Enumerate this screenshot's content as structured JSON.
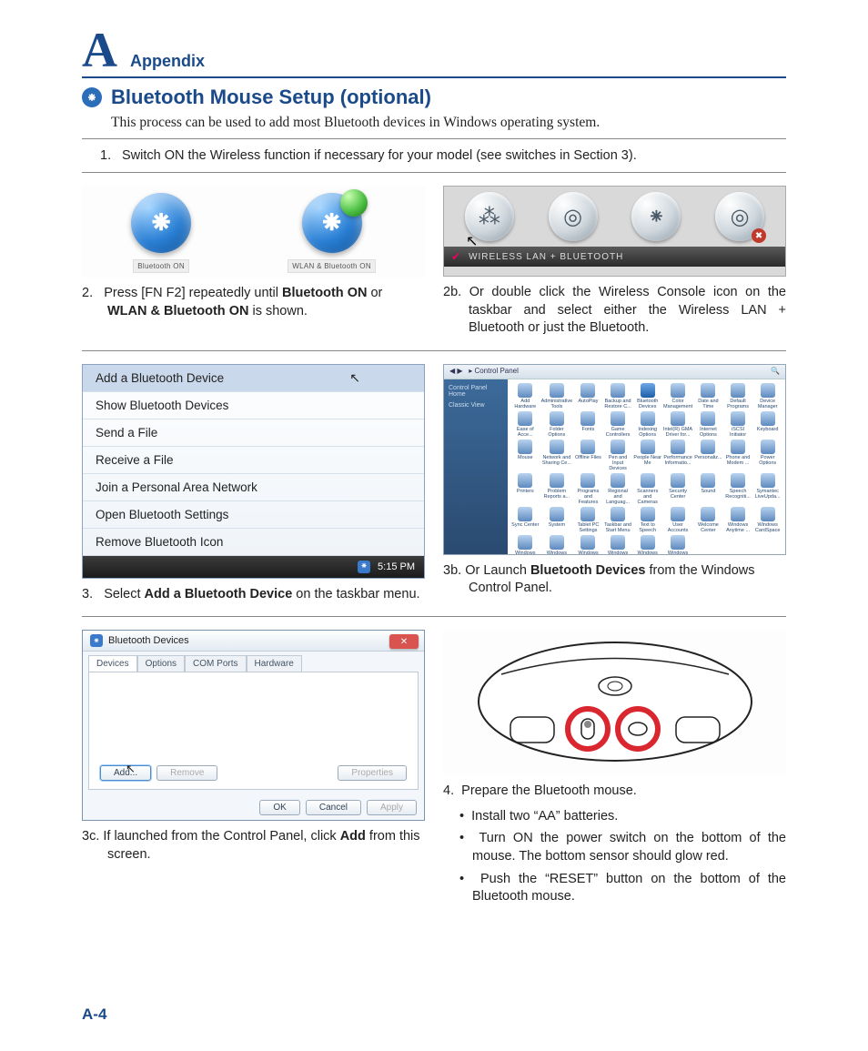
{
  "header": {
    "letter": "A",
    "label": "Appendix"
  },
  "title": "Bluetooth Mouse Setup (optional)",
  "intro": "This process can be used to add most Bluetooth devices in Windows operating system.",
  "step1": {
    "num": "1.",
    "text": "Switch ON the Wireless function if necessary for your model (see switches in Section 3)."
  },
  "fig_icons": {
    "left_cap": "Bluetooth ON",
    "right_cap": "WLAN & Bluetooth ON"
  },
  "console_bar": "Wireless Lan + Bluetooth",
  "step2": {
    "num": "2.",
    "pre": "Press [FN F2] repeatedly until ",
    "b1": "Bluetooth ON",
    "mid": " or ",
    "b2": "WLAN & Bluetooth ON",
    "post": " is shown."
  },
  "step2b": {
    "num": "2b.",
    "text": "Or double click the Wireless Console icon on the taskbar and select either the Wireless LAN + Bluetooth or just the Bluetooth."
  },
  "menu": {
    "items": [
      "Add a Bluetooth Device",
      "Show Bluetooth Devices",
      "Send a File",
      "Receive a File",
      "Join a Personal Area Network",
      "Open Bluetooth Settings",
      "Remove Bluetooth Icon"
    ],
    "time": "5:15 PM"
  },
  "cp": {
    "title": "Control Panel",
    "side1": "Control Panel Home",
    "side2": "Classic View",
    "items": [
      "Add Hardware",
      "Administrative Tools",
      "AutoPlay",
      "Backup and Restore C...",
      "Bluetooth Devices",
      "Color Management",
      "Date and Time",
      "Default Programs",
      "Device Manager",
      "Ease of Acce...",
      "Folder Options",
      "Fonts",
      "Game Controllers",
      "Indexing Options",
      "Intel(R) GMA Driver for...",
      "Internet Options",
      "iSCSI Initiator",
      "Keyboard",
      "Mouse",
      "Network and Sharing Ce...",
      "Offline Files",
      "Pen and Input Devices",
      "People Near Me",
      "Performance Informatio...",
      "Personaliz...",
      "Phone and Modem ...",
      "Power Options",
      "Printers",
      "Problem Reports a...",
      "Programs and Features",
      "Regional and Languag...",
      "Scanners and Cameras",
      "Security Center",
      "Sound",
      "Speech Recogniti...",
      "Symantec LiveUpda...",
      "Sync Center",
      "System",
      "Tablet PC Settings",
      "Taskbar and Start Menu",
      "Text to Speech",
      "User Accounts",
      "Welcome Center",
      "Windows Anytime ...",
      "Windows CardSpace",
      "Windows Defender",
      "Windows Firewall",
      "Windows Mobilit...",
      "Windows Sidebar ...",
      "Windows SlideShow",
      "Windows Update"
    ]
  },
  "step3": {
    "num": "3.",
    "pre": "Select ",
    "b": "Add a Bluetooth Device",
    "post": " on the taskbar menu."
  },
  "step3b": {
    "num": "3b.",
    "pre": "Or Launch ",
    "b": "Bluetooth Devices",
    "post": " from the Windows Control Panel."
  },
  "dlg": {
    "title": "Bluetooth Devices",
    "tabs": [
      "Devices",
      "Options",
      "COM Ports",
      "Hardware"
    ],
    "add": "Add...",
    "remove": "Remove",
    "props": "Properties",
    "ok": "OK",
    "cancel": "Cancel",
    "apply": "Apply"
  },
  "step3c": {
    "num": "3c.",
    "pre": "If launched from the Control Panel, click ",
    "b": "Add",
    "post": " from this screen."
  },
  "step4": {
    "num": "4.",
    "text": "Prepare the Bluetooth mouse."
  },
  "bullets": [
    "Install two “AA” batteries.",
    "Turn ON the power switch on the bottom of the mouse. The bottom sensor should glow red.",
    "Push the “RESET” button on the bottom of the Bluetooth mouse."
  ],
  "page": "A-4",
  "glyphs": {
    "bt": "⤬",
    "wifi": "↯"
  }
}
